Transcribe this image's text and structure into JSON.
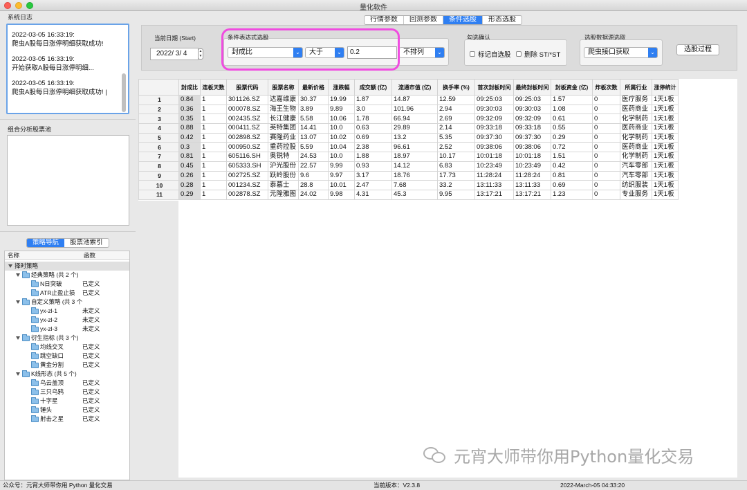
{
  "window": {
    "title": "量化软件"
  },
  "left": {
    "log_label": "系统日志",
    "log_entries": [
      {
        "time": "2022-03-05 16:33:19:",
        "msg": "爬虫A股每日涨停明细获取成功!"
      },
      {
        "time": "2022-03-05 16:33:19:",
        "msg": "开始获取A股每日涨停明细..."
      },
      {
        "time": "2022-03-05 16:33:19:",
        "msg": "爬虫A股每日涨停明细获取成功! |"
      }
    ],
    "pool_label": "组合分析股票池",
    "nav_tabs": [
      {
        "label": "策略导航",
        "active": true
      },
      {
        "label": "股票池索引",
        "active": false
      }
    ],
    "tree": {
      "col_name": "名称",
      "col_func": "函数",
      "root": "择时策略",
      "groups": [
        {
          "label": "经典策略 (共 2 个)",
          "items": [
            {
              "name": "N日突破",
              "status": "已定义"
            },
            {
              "name": "ATR止盈止损",
              "status": "已定义"
            }
          ]
        },
        {
          "label": "自定义策略 (共 3 个",
          "items": [
            {
              "name": "yx-zl-1",
              "status": "未定义"
            },
            {
              "name": "yx-zl-2",
              "status": "未定义"
            },
            {
              "name": "yx-zl-3",
              "status": "未定义"
            }
          ]
        },
        {
          "label": "衍生指标 (共 3 个)",
          "items": [
            {
              "name": "均线交叉",
              "status": "已定义"
            },
            {
              "name": "跳空缺口",
              "status": "已定义"
            },
            {
              "name": "黄金分割",
              "status": "已定义"
            }
          ]
        },
        {
          "label": "K线形态 (共 5 个)",
          "items": [
            {
              "name": "乌云盖顶",
              "status": "已定义"
            },
            {
              "name": "三只乌鸦",
              "status": "已定义"
            },
            {
              "name": "十字星",
              "status": "已定义"
            },
            {
              "name": "锤头",
              "status": "已定义"
            },
            {
              "name": "射击之星",
              "status": "已定义"
            }
          ]
        }
      ]
    }
  },
  "top_tabs": [
    {
      "label": "行情参数",
      "active": false
    },
    {
      "label": "回测参数",
      "active": false
    },
    {
      "label": "条件选股",
      "active": true
    },
    {
      "label": "形态选股",
      "active": false
    }
  ],
  "filter": {
    "date_label": "当前日期 (Start)",
    "date_value": "2022/ 3/ 4",
    "expr_label": "条件表达式选股",
    "field_value": "封成比",
    "op_value": "大于",
    "threshold_value": "0.2",
    "sort_value": "不排列",
    "check_label": "勾选确认",
    "check_mark": "标记自选股",
    "check_delete": "删除 ST/*ST",
    "source_label": "选股数据源选取",
    "source_value": "爬虫接口获取",
    "run_button": "选股过程",
    "stepper_up": "▲",
    "stepper_down": "▼",
    "arrow": "⌄"
  },
  "table": {
    "columns": [
      "封成比",
      "连板天数",
      "股票代码",
      "股票名称",
      "最新价格",
      "涨跌幅",
      "成交额 (亿)",
      "流通市值 (亿)",
      "换手率 (%)",
      "首次封板时间",
      "最终封板时间",
      "封板资金 (亿)",
      "炸板次数",
      "所属行业",
      "涨停统计"
    ],
    "rows": [
      [
        "1",
        "0.84",
        "1",
        "301126.SZ",
        "达嘉维康",
        "30.37",
        "19.99",
        "1.87",
        "14.87",
        "12.59",
        "09:25:03",
        "09:25:03",
        "1.57",
        "0",
        "医疗服务",
        "1天1板"
      ],
      [
        "2",
        "0.36",
        "1",
        "000078.SZ",
        "海王生物",
        "3.89",
        "9.89",
        "3.0",
        "101.96",
        "2.94",
        "09:30:03",
        "09:30:03",
        "1.08",
        "0",
        "医药商业",
        "1天1板"
      ],
      [
        "3",
        "0.35",
        "1",
        "002435.SZ",
        "长江健康",
        "5.58",
        "10.06",
        "1.78",
        "66.94",
        "2.69",
        "09:32:09",
        "09:32:09",
        "0.61",
        "0",
        "化学制药",
        "1天1板"
      ],
      [
        "4",
        "0.88",
        "1",
        "000411.SZ",
        "英特集团",
        "14.41",
        "10.0",
        "0.63",
        "29.89",
        "2.14",
        "09:33:18",
        "09:33:18",
        "0.55",
        "0",
        "医药商业",
        "1天1板"
      ],
      [
        "5",
        "0.42",
        "1",
        "002898.SZ",
        "赛隆药业",
        "13.07",
        "10.02",
        "0.69",
        "13.2",
        "5.35",
        "09:37:30",
        "09:37:30",
        "0.29",
        "0",
        "化学制药",
        "1天1板"
      ],
      [
        "6",
        "0.3",
        "1",
        "000950.SZ",
        "重药控股",
        "5.59",
        "10.04",
        "2.38",
        "96.61",
        "2.52",
        "09:38:06",
        "09:38:06",
        "0.72",
        "0",
        "医药商业",
        "1天1板"
      ],
      [
        "7",
        "0.81",
        "1",
        "605116.SH",
        "奥锐特",
        "24.53",
        "10.0",
        "1.88",
        "18.97",
        "10.17",
        "10:01:18",
        "10:01:18",
        "1.51",
        "0",
        "化学制药",
        "1天1板"
      ],
      [
        "8",
        "0.45",
        "1",
        "605333.SH",
        "沪光股份",
        "22.57",
        "9.99",
        "0.93",
        "14.12",
        "6.83",
        "10:23:49",
        "10:23:49",
        "0.42",
        "0",
        "汽车零部",
        "1天1板"
      ],
      [
        "9",
        "0.26",
        "1",
        "002725.SZ",
        "跃岭股份",
        "9.6",
        "9.97",
        "3.17",
        "18.76",
        "17.73",
        "11:28:24",
        "11:28:24",
        "0.81",
        "0",
        "汽车零部",
        "1天1板"
      ],
      [
        "10",
        "0.28",
        "1",
        "001234.SZ",
        "泰慕士",
        "28.8",
        "10.01",
        "2.47",
        "7.68",
        "33.2",
        "13:11:33",
        "13:11:33",
        "0.69",
        "0",
        "纺织服装",
        "1天1板"
      ],
      [
        "11",
        "0.29",
        "1",
        "002878.SZ",
        "元隆雅图",
        "24.02",
        "9.98",
        "4.31",
        "45.3",
        "9.95",
        "13:17:21",
        "13:17:21",
        "1.23",
        "0",
        "专业服务",
        "1天1板"
      ]
    ]
  },
  "watermark": "元宵大师带你用Python量化交易",
  "status": {
    "left": "公众号：元宵大师带你用 Python 量化交易",
    "version": "当前版本：V2.3.8",
    "datetime": "2022-March-05 04:33:20"
  },
  "colors": {
    "accent": "#2f7ff2",
    "highlight": "#f04ce0",
    "log_border": "#6aa3e8"
  },
  "icons": {
    "folder": "folder-icon",
    "disclosure": "disclosure-triangle-icon",
    "watermark": "wechat-icon"
  }
}
